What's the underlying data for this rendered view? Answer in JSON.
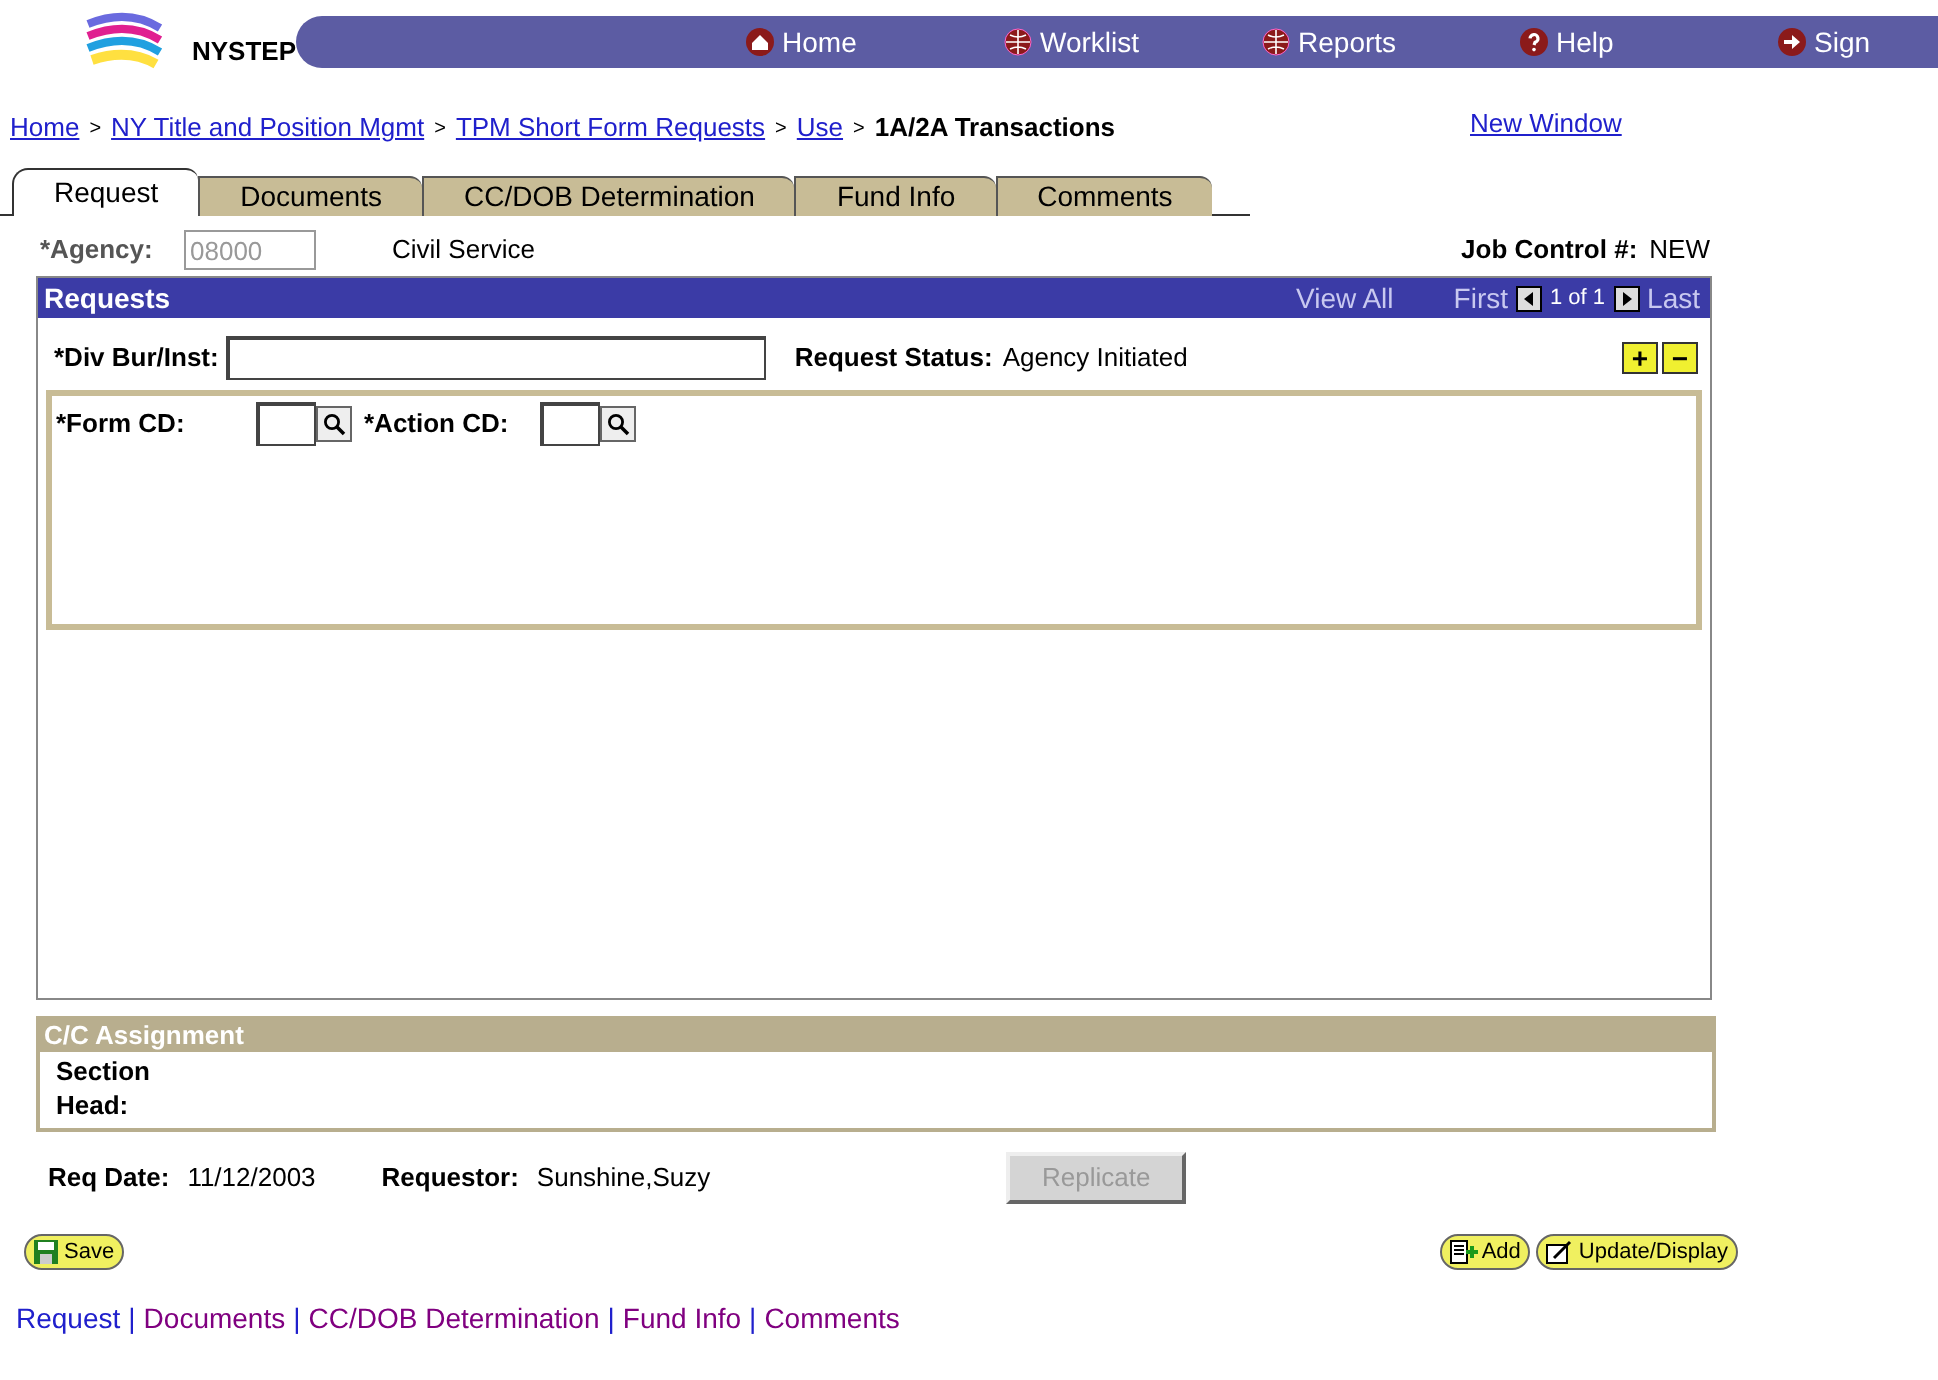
{
  "header": {
    "app_name": "NYSTEP",
    "nav": [
      {
        "label": "Home",
        "kind": "home"
      },
      {
        "label": "Worklist",
        "kind": "globe"
      },
      {
        "label": "Reports",
        "kind": "globe"
      },
      {
        "label": "Help",
        "kind": "help"
      },
      {
        "label": "Sign",
        "kind": "arrow"
      }
    ]
  },
  "breadcrumb": {
    "links": [
      "Home",
      "NY Title and Position Mgmt",
      "TPM Short Form Requests",
      "Use"
    ],
    "separator": ">",
    "current": "1A/2A Transactions"
  },
  "new_window": "New Window",
  "tabs": [
    {
      "label": "Request",
      "selected": true
    },
    {
      "label": "Documents",
      "selected": false
    },
    {
      "label": "CC/DOB Determination",
      "selected": false
    },
    {
      "label": "Fund Info",
      "selected": false
    },
    {
      "label": "Comments",
      "selected": false
    }
  ],
  "agency": {
    "label": "*Agency:",
    "value": "08000",
    "name": "Civil Service",
    "disabled": true
  },
  "job_control": {
    "label": "Job Control #:",
    "value": "NEW"
  },
  "requests": {
    "title": "Requests",
    "view_all": "View All",
    "first": "First",
    "count": "1 of 1",
    "last": "Last",
    "div_label": "*Div Bur/Inst:",
    "status_label": "Request Status:",
    "status_value": "Agency Initiated",
    "add": "+",
    "remove": "−",
    "form_cd_label": "*Form CD:",
    "action_cd_label": "*Action CD:"
  },
  "assignment": {
    "title": "C/C Assignment",
    "section_head_label": "Section Head:"
  },
  "footer_info": {
    "req_date_label": "Req Date:",
    "req_date": "11/12/2003",
    "requestor_label": "Requestor:",
    "requestor": "Sunshine,Suzy",
    "replicate": "Replicate",
    "replicate_disabled": true
  },
  "actions": {
    "save": "Save",
    "add": "Add",
    "update": "Update/Display"
  },
  "bottom_links": [
    {
      "label": "Request",
      "visited": false
    },
    {
      "label": "Documents",
      "visited": true
    },
    {
      "label": "CC/DOB Determination",
      "visited": true
    },
    {
      "label": "Fund Info",
      "visited": true
    },
    {
      "label": "Comments",
      "visited": true
    }
  ],
  "bottom_separator": "|"
}
